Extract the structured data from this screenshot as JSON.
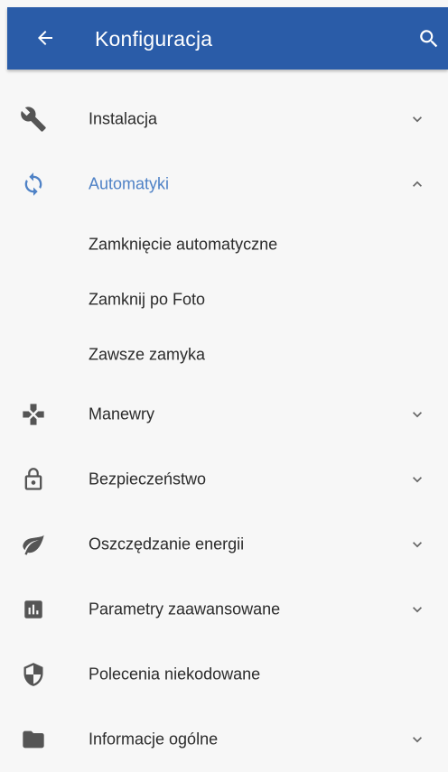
{
  "appbar": {
    "title": "Konfiguracja",
    "back_icon": "arrow-back-icon",
    "search_icon": "search-icon",
    "color": "#2a5ca8"
  },
  "menu": {
    "accent_color": "#4f82c6",
    "items": [
      {
        "label": "Instalacja",
        "icon": "wrench-icon",
        "expandable": true,
        "expanded": false
      },
      {
        "label": "Automatyki",
        "icon": "sync-icon",
        "expandable": true,
        "expanded": true,
        "subitems": [
          "Zamknięcie automatyczne",
          "Zamknij po Foto",
          "Zawsze zamyka"
        ]
      },
      {
        "label": "Manewry",
        "icon": "gamepad-icon",
        "expandable": true,
        "expanded": false
      },
      {
        "label": "Bezpieczeństwo",
        "icon": "lock-icon",
        "expandable": true,
        "expanded": false
      },
      {
        "label": "Oszczędzanie energii",
        "icon": "leaf-icon",
        "expandable": true,
        "expanded": false
      },
      {
        "label": "Parametry zaawansowane",
        "icon": "chart-icon",
        "expandable": true,
        "expanded": false
      },
      {
        "label": "Polecenia niekodowane",
        "icon": "shield-icon",
        "expandable": false,
        "expanded": false
      },
      {
        "label": "Informacje ogólne",
        "icon": "folder-icon",
        "expandable": true,
        "expanded": false
      }
    ]
  }
}
